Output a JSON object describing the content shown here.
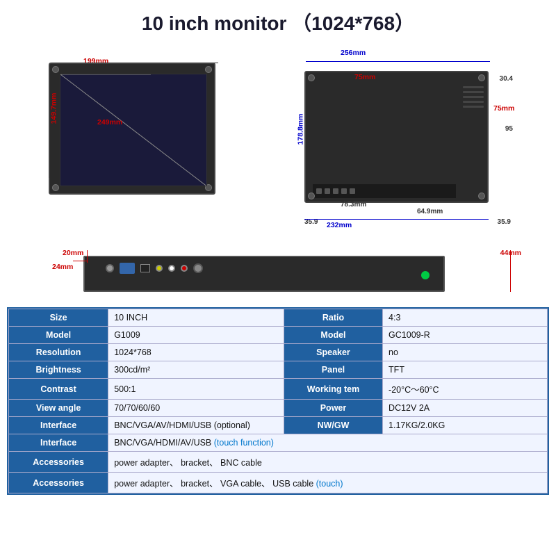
{
  "title": "10 inch monitor （1024*768）",
  "diagrams": {
    "front": {
      "dim_h": "199mm",
      "dim_v": "149.7mm",
      "dim_diag": "249mm"
    },
    "back": {
      "dim_top": "256mm",
      "dim_inner_h": "75mm",
      "dim_inner_v": "75mm",
      "dim_side_h": "178.8mm",
      "dim_78": "78.3mm",
      "dim_64": "64.9mm",
      "dim_30": "30.4",
      "dim_95": "95",
      "dim_35l": "35.9",
      "dim_35r": "35.9",
      "dim_bottom": "232mm"
    },
    "side": {
      "dim_20": "20mm",
      "dim_24": "24mm",
      "dim_44": "44mm"
    }
  },
  "specs": {
    "rows": [
      {
        "label1": "Size",
        "value1": "10 INCH",
        "label2": "Ratio",
        "value2": "4:3"
      },
      {
        "label1": "Model",
        "value1": "G1009",
        "label2": "Model",
        "value2": "GC1009-R"
      },
      {
        "label1": "Resolution",
        "value1": "1024*768",
        "label2": "Speaker",
        "value2": "no"
      },
      {
        "label1": "Brightness",
        "value1": "300cd/m²",
        "label2": "Panel",
        "value2": "TFT"
      },
      {
        "label1": "Contrast",
        "value1": "500:1",
        "label2": "Working tem",
        "value2": "-20°C～60°C"
      },
      {
        "label1": "View angle",
        "value1": "70/70/60/60",
        "label2": "Power",
        "value2": "DC12V  2A"
      },
      {
        "label1": "Interface",
        "value1": "BNC/VGA/AV/HDMI/USB (optional)",
        "label2": "NW/GW",
        "value2": "1.17KG/2.0KG"
      }
    ],
    "extra_rows": [
      {
        "label": "Interface",
        "value": "BNC/VGA/HDMI/AV/USB",
        "touch": " (touch function)"
      },
      {
        "label": "Accessories",
        "value": "power adapter、 bracket、 BNC cable",
        "touch": ""
      },
      {
        "label": "Accessories",
        "value": "power adapter、 bracket、 VGA cable、 USB cable",
        "touch": " (touch)"
      }
    ]
  }
}
